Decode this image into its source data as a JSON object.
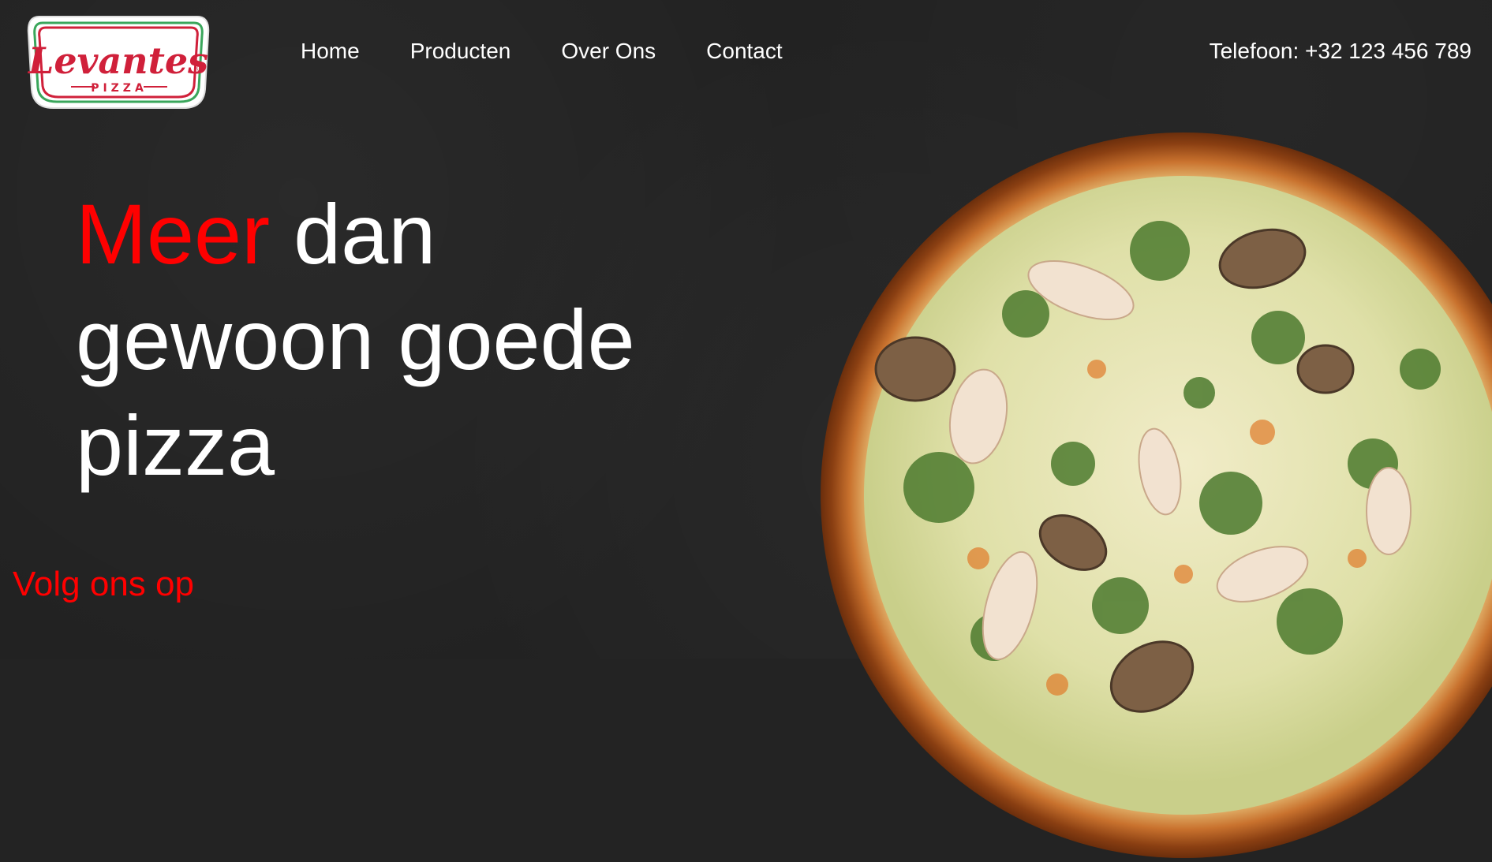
{
  "brand": {
    "logo_script": "Levantes",
    "logo_sub": "PIZZA",
    "logo_mark": "®"
  },
  "nav": {
    "items": [
      "Home",
      "Producten",
      "Over Ons",
      "Contact"
    ]
  },
  "contact": {
    "phone": "Telefoon: +32 123 456 789"
  },
  "hero": {
    "accent_word": "Meer",
    "line1_rest": " dan",
    "line2": "gewoon goede",
    "line3": "pizza"
  },
  "social": {
    "label": "Volg ons op"
  },
  "colors": {
    "accent": "#ff0000",
    "background": "#232323",
    "logo_red": "#d0203a",
    "logo_green": "#3aa65b"
  }
}
